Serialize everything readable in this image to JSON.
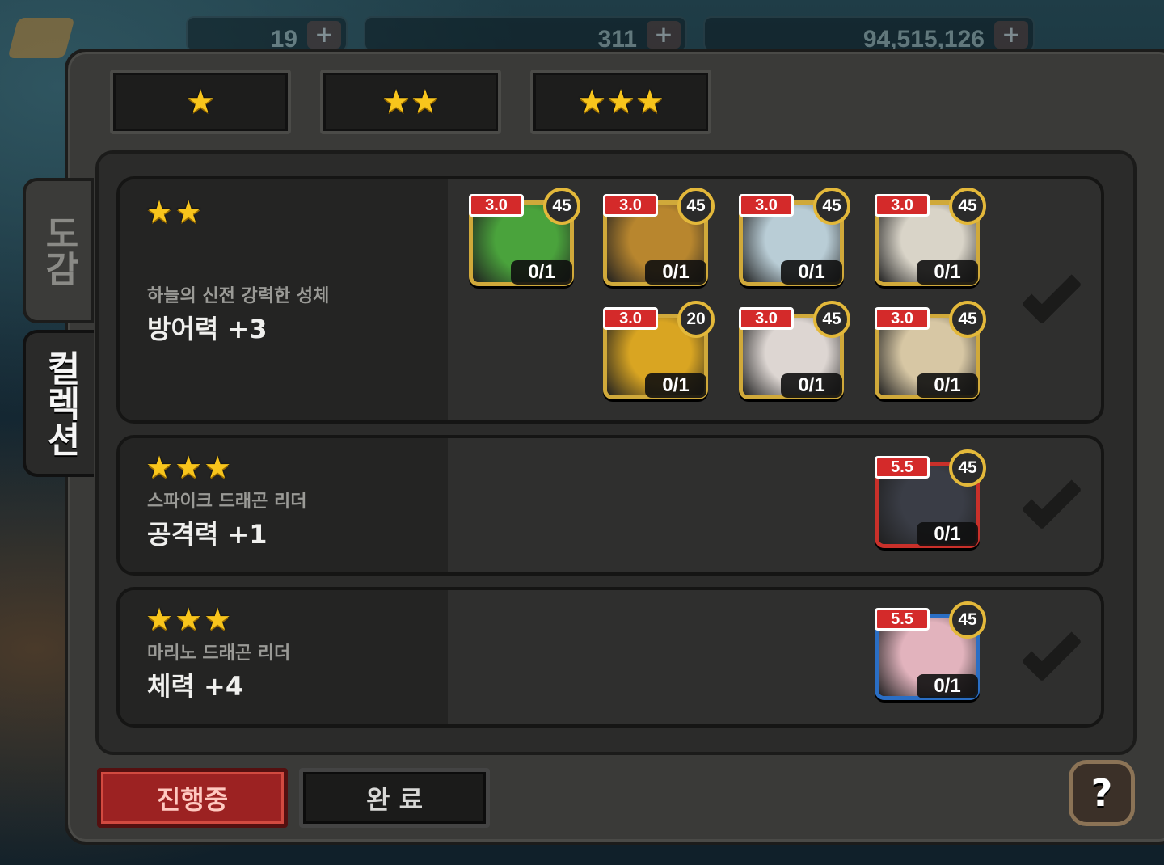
{
  "top_bar": {
    "resources": [
      {
        "icon": "gem-icon",
        "value": "19"
      },
      {
        "icon": "crystal-icon",
        "value": "311"
      },
      {
        "icon": "gold-icon",
        "value": "94,515,126"
      }
    ],
    "plus_label": "+"
  },
  "star_tabs": [
    {
      "stars": "★"
    },
    {
      "stars": "★★"
    },
    {
      "stars": "★★★"
    }
  ],
  "side_tabs": {
    "dogam": "도감",
    "collection": "컬렉션"
  },
  "collections": [
    {
      "stars": "★★",
      "name": "하늘의 신전 강력한 성체",
      "effect": "방어력 +3",
      "monsters": [
        {
          "level": "3.0",
          "rank": "45",
          "count": "0/1",
          "color": "#4aa33c"
        },
        {
          "level": "3.0",
          "rank": "45",
          "count": "0/1",
          "color": "#b8862e"
        },
        {
          "level": "3.0",
          "rank": "45",
          "count": "0/1",
          "color": "#b9cdd6"
        },
        {
          "level": "3.0",
          "rank": "45",
          "count": "0/1",
          "color": "#d9d4c8"
        },
        {
          "level": "3.0",
          "rank": "20",
          "count": "0/1",
          "color": "#d9a522"
        },
        {
          "level": "3.0",
          "rank": "45",
          "count": "0/1",
          "color": "#ddd6d2"
        },
        {
          "level": "3.0",
          "rank": "45",
          "count": "0/1",
          "color": "#d7c7a4"
        }
      ]
    },
    {
      "stars": "★★★",
      "name": "스파이크 드래곤 리더",
      "effect": "공격력 +1",
      "monsters": [
        {
          "level": "5.5",
          "rank": "45",
          "count": "0/1",
          "color": "#3a3d46"
        }
      ]
    },
    {
      "stars": "★★★",
      "name": "마리노 드래곤 리더",
      "effect": "체력 +4",
      "monsters": [
        {
          "level": "5.5",
          "rank": "45",
          "count": "0/1",
          "color": "#e2b3bd"
        }
      ]
    }
  ],
  "footer": {
    "in_progress": "진행중",
    "complete": "완 료",
    "help": "?"
  }
}
